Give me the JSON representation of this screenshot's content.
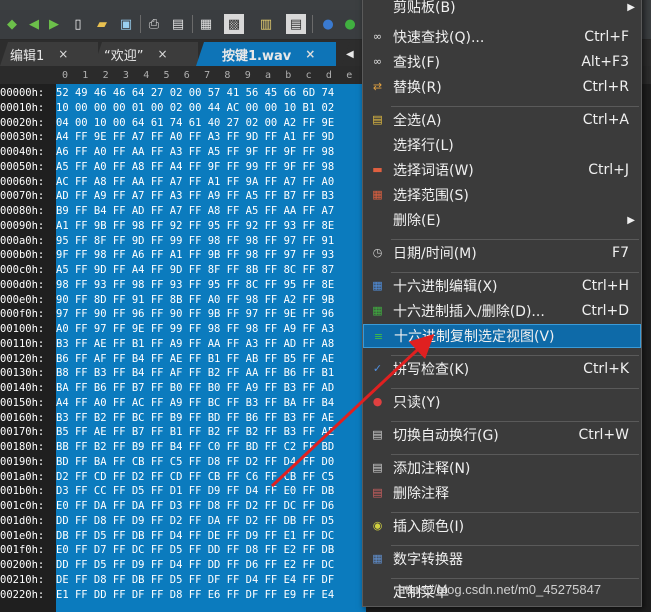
{
  "tabs": [
    {
      "label": "编辑1",
      "close": "×"
    },
    {
      "label": "“欢迎”",
      "close": "×"
    },
    {
      "label": "按键1.wav",
      "close": "×"
    }
  ],
  "ruler": [
    "0",
    "1",
    "2",
    "3",
    "4",
    "5",
    "6",
    "7",
    "8",
    "9",
    "a",
    "b",
    "c",
    "d",
    "e"
  ],
  "rows": [
    {
      "addr": "00000h:",
      "hex": "52 49 46 46 64 27 02 00 57 41 56 45 66 6D 74"
    },
    {
      "addr": "00010h:",
      "hex": "10 00 00 00 01 00 02 00 44 AC 00 00 10 B1 02"
    },
    {
      "addr": "00020h:",
      "hex": "04 00 10 00 64 61 74 61 40 27 02 00 A2 FF 9E"
    },
    {
      "addr": "00030h:",
      "hex": "A4 FF 9E FF A7 FF A0 FF A3 FF 9D FF A1 FF 9D"
    },
    {
      "addr": "00040h:",
      "hex": "A6 FF A0 FF AA FF A3 FF A5 FF 9F FF 9F FF 98"
    },
    {
      "addr": "00050h:",
      "hex": "A5 FF A0 FF A8 FF A4 FF 9F FF 99 FF 9F FF 98"
    },
    {
      "addr": "00060h:",
      "hex": "AC FF A8 FF AA FF A7 FF A1 FF 9A FF A7 FF A0"
    },
    {
      "addr": "00070h:",
      "hex": "AD FF A9 FF A7 FF A3 FF A9 FF A5 FF B7 FF B3"
    },
    {
      "addr": "00080h:",
      "hex": "B9 FF B4 FF AD FF A7 FF A8 FF A5 FF AA FF A7"
    },
    {
      "addr": "00090h:",
      "hex": "A1 FF 9B FF 98 FF 92 FF 95 FF 92 FF 93 FF 8E"
    },
    {
      "addr": "000a0h:",
      "hex": "95 FF 8F FF 9D FF 99 FF 98 FF 98 FF 97 FF 91"
    },
    {
      "addr": "000b0h:",
      "hex": "9F FF 98 FF A6 FF A1 FF 9B FF 98 FF 97 FF 93"
    },
    {
      "addr": "000c0h:",
      "hex": "A5 FF 9D FF A4 FF 9D FF 8F FF 8B FF 8C FF 87"
    },
    {
      "addr": "000d0h:",
      "hex": "98 FF 93 FF 98 FF 93 FF 95 FF 8C FF 95 FF 8E"
    },
    {
      "addr": "000e0h:",
      "hex": "90 FF 8D FF 91 FF 8B FF A0 FF 98 FF A2 FF 9B"
    },
    {
      "addr": "000f0h:",
      "hex": "97 FF 90 FF 96 FF 90 FF 9B FF 97 FF 9E FF 96"
    },
    {
      "addr": "00100h:",
      "hex": "A0 FF 97 FF 9E FF 99 FF 98 FF 98 FF A9 FF A3"
    },
    {
      "addr": "00110h:",
      "hex": "B3 FF AE FF B1 FF A9 FF AA FF A3 FF AD FF A8"
    },
    {
      "addr": "00120h:",
      "hex": "B6 FF AF FF B4 FF AE FF B1 FF AB FF B5 FF AE"
    },
    {
      "addr": "00130h:",
      "hex": "B8 FF B3 FF B4 FF AF FF B2 FF AA FF B6 FF B1"
    },
    {
      "addr": "00140h:",
      "hex": "BA FF B6 FF B7 FF B0 FF B0 FF A9 FF B3 FF AD"
    },
    {
      "addr": "00150h:",
      "hex": "A4 FF A0 FF AC FF A9 FF BC FF B3 FF BA FF B4"
    },
    {
      "addr": "00160h:",
      "hex": "B3 FF B2 FF BC FF B9 FF BD FF B6 FF B3 FF AE"
    },
    {
      "addr": "00170h:",
      "hex": "B5 FF AE FF B7 FF B1 FF B2 FF B2 FF B3 FF AE"
    },
    {
      "addr": "00180h:",
      "hex": "BB FF B2 FF B9 FF B4 FF C0 FF BD FF C2 FF BD"
    },
    {
      "addr": "00190h:",
      "hex": "BD FF BA FF CB FF C5 FF D8 FF D2 FF D4 FF D0"
    },
    {
      "addr": "001a0h:",
      "hex": "D2 FF CD FF D2 FF CD FF CB FF C6 FF CB FF C5"
    },
    {
      "addr": "001b0h:",
      "hex": "D3 FF CC FF D5 FF D1 FF D9 FF D4 FF E0 FF DB"
    },
    {
      "addr": "001c0h:",
      "hex": "E0 FF DA FF DA FF D3 FF D8 FF D2 FF DC FF D6"
    },
    {
      "addr": "001d0h:",
      "hex": "DD FF D8 FF D9 FF D2 FF DA FF D2 FF DB FF D5"
    },
    {
      "addr": "001e0h:",
      "hex": "DB FF D5 FF DB FF D4 FF DE FF D9 FF E1 FF DC"
    },
    {
      "addr": "001f0h:",
      "hex": "E0 FF D7 FF DC FF D5 FF DD FF D8 FF E2 FF DB"
    },
    {
      "addr": "00200h:",
      "hex": "DD FF D5 FF D9 FF D4 FF DD FF D6 FF E2 FF DC"
    },
    {
      "addr": "00210h:",
      "hex": "DE FF D8 FF DB FF D5 FF DF FF D4 FF E4 FF DF"
    },
    {
      "addr": "00220h:",
      "hex": "E1 FF DD FF DF FF D8 FF E6 FF DF FF E9 FF E4"
    }
  ],
  "menu": {
    "items": [
      {
        "label": "剪贴板(B)",
        "shortcut": "",
        "submenu": true,
        "icon": "none"
      },
      {
        "label": "快速查找(Q)...",
        "shortcut": "Ctrl+F",
        "icon": "binoculars-icon"
      },
      {
        "label": "查找(F)",
        "shortcut": "Alt+F3",
        "icon": "find-icon"
      },
      {
        "label": "替换(R)",
        "shortcut": "Ctrl+R",
        "icon": "replace-icon"
      },
      {
        "label": "全选(A)",
        "shortcut": "Ctrl+A",
        "icon": "select-all-icon"
      },
      {
        "label": "选择行(L)",
        "shortcut": "",
        "icon": "none"
      },
      {
        "label": "选择词语(W)",
        "shortcut": "Ctrl+J",
        "icon": "select-word-icon"
      },
      {
        "label": "选择范围(S)",
        "shortcut": "",
        "icon": "select-range-icon"
      },
      {
        "label": "删除(E)",
        "shortcut": "",
        "submenu": true,
        "icon": "none"
      },
      {
        "label": "日期/时间(M)",
        "shortcut": "F7",
        "icon": "clock-icon"
      },
      {
        "label": "十六进制编辑(X)",
        "shortcut": "Ctrl+H",
        "icon": "hex-edit-icon"
      },
      {
        "label": "十六进制插入/删除(D)...",
        "shortcut": "Ctrl+D",
        "icon": "hex-insert-icon"
      },
      {
        "label": "十六进制复制选定视图(V)",
        "shortcut": "",
        "icon": "hex-copy-icon"
      },
      {
        "label": "拼写检查(K)",
        "shortcut": "Ctrl+K",
        "icon": "spellcheck-icon"
      },
      {
        "label": "只读(Y)",
        "shortcut": "",
        "icon": "readonly-icon"
      },
      {
        "label": "切换自动换行(G)",
        "shortcut": "Ctrl+W",
        "icon": "wordwrap-icon"
      },
      {
        "label": "添加注释(N)",
        "shortcut": "",
        "icon": "add-comment-icon"
      },
      {
        "label": "删除注释",
        "shortcut": "",
        "icon": "remove-comment-icon"
      },
      {
        "label": "插入颜色(I)",
        "shortcut": "",
        "icon": "color-icon"
      },
      {
        "label": "数字转换器",
        "shortcut": "",
        "icon": "converter-icon"
      },
      {
        "label": "定制菜单",
        "shortcut": "",
        "icon": "none"
      }
    ]
  },
  "watermark": "https://blog.csdn.net/m0_45275847",
  "colors": {
    "selection": "#0b7bbe",
    "menu_bg": "#3b3b3b",
    "menu_highlight": "#0e6aa8",
    "active_tab": "#0e74b7",
    "arrow": "#e02020"
  }
}
